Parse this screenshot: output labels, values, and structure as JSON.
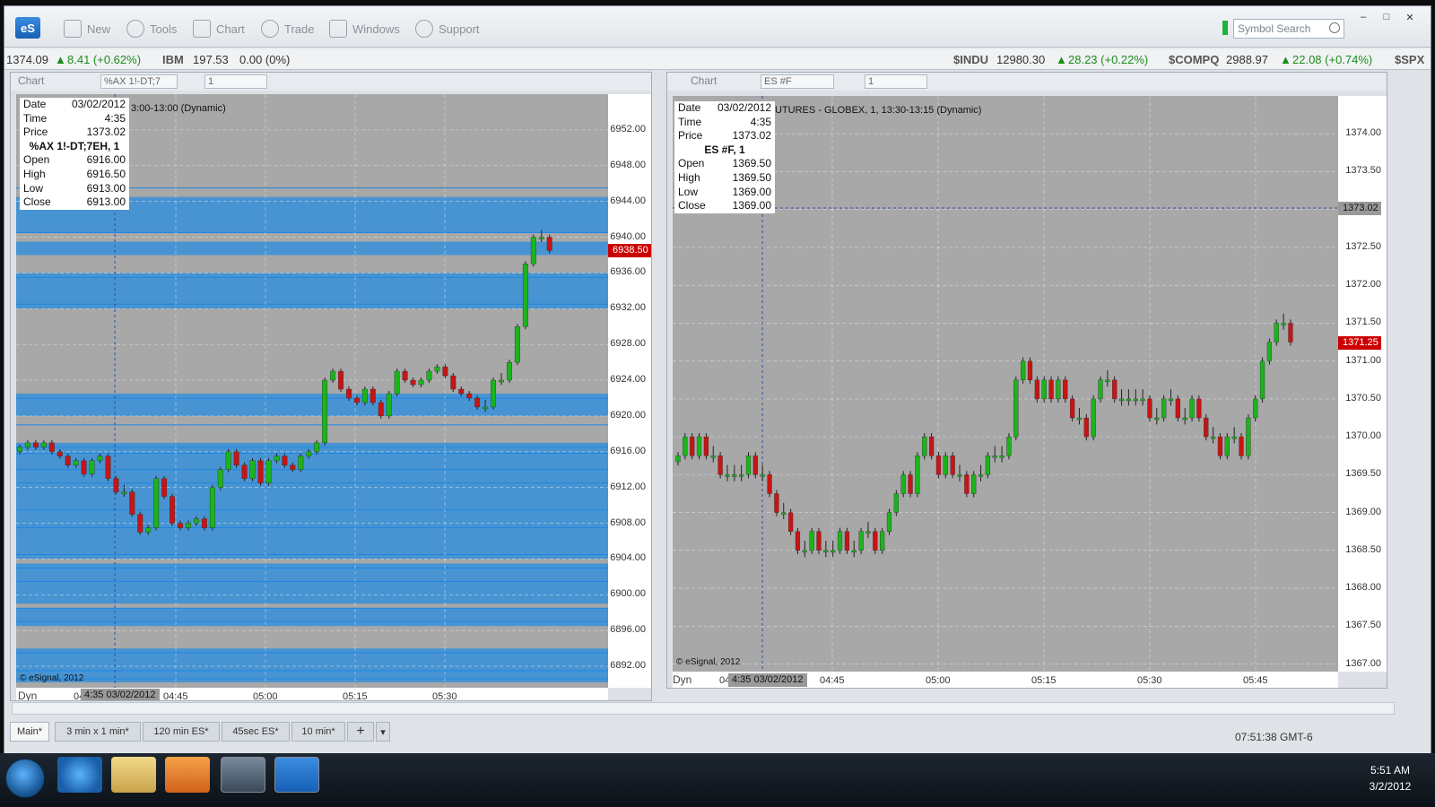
{
  "app": {
    "logo": "eS",
    "menu": [
      "New",
      "Tools",
      "Chart",
      "Trade",
      "Windows",
      "Support"
    ],
    "symbol_search_placeholder": "Symbol Search"
  },
  "ticker": {
    "item1_price": "1374.09",
    "item1_change": "8.41 (+0.62%)",
    "ibm_sym": "IBM",
    "ibm_price": "197.53",
    "ibm_change": "0.00 (0%)",
    "indu_sym": "$INDU",
    "indu_price": "12980.30",
    "indu_change": "28.23 (+0.22%)",
    "compq_sym": "$COMPQ",
    "compq_price": "2988.97",
    "compq_change": "22.08 (+0.74%)",
    "spx_sym": "$SPX"
  },
  "colors": {
    "plot_bg": "#a8a8a8",
    "band": "#208ce6",
    "up": "#19b51b",
    "down": "#c81414",
    "last_tag": "#cc0000"
  },
  "chart_data": [
    {
      "type": "candlestick",
      "window_label": "Chart",
      "symbol_field": "%AX 1!-DT;7",
      "interval_field": "1",
      "title": "3:00-13:00 (Dynamic)",
      "ylim": [
        6889.6,
        6956.0
      ],
      "yticks": [
        6952,
        6948,
        6944,
        6940,
        6936,
        6932,
        6928,
        6924,
        6920,
        6916,
        6912,
        6908,
        6904,
        6900,
        6896,
        6892
      ],
      "ytick_labels": [
        "6952.00",
        "6948.00",
        "6944.00",
        "6940.00",
        "6936.00",
        "6932.00",
        "6928.00",
        "6924.00",
        "6920.00",
        "6916.00",
        "6912.00",
        "6908.00",
        "6904.00",
        "6900.00",
        "6896.00",
        "6892.00"
      ],
      "xticks": [
        "04:45",
        "05:00",
        "05:15",
        "05:30"
      ],
      "last_price": "6938.50",
      "cursor_time": "4:35 03/02/2012",
      "cursor_time_prefix": "04",
      "data_window": {
        "date_label": "Date",
        "date": "03/02/2012",
        "time_label": "Time",
        "time": "4:35",
        "price_label": "Price",
        "price": "1373.02",
        "symbol": "%AX 1!-DT;7EH, 1",
        "open_label": "Open",
        "open": "6916.00",
        "high_label": "High",
        "high": "6916.50",
        "low_label": "Low",
        "low": "6913.00",
        "close_label": "Close",
        "close": "6913.00"
      },
      "copyright": "© eSignal, 2012",
      "dyn_label": "Dyn",
      "closes": [
        6916.5,
        6917,
        6916.5,
        6917,
        6916,
        6915.5,
        6914.5,
        6915,
        6913.5,
        6915,
        6915.5,
        6913,
        6911.5,
        6911.5,
        6909,
        6907,
        6907.5,
        6913,
        6911,
        6908,
        6907.5,
        6908,
        6908.5,
        6907.5,
        6912,
        6914,
        6916,
        6914.5,
        6913,
        6915,
        6912.5,
        6915,
        6915.5,
        6914.5,
        6914,
        6915.5,
        6916,
        6917,
        6924,
        6925,
        6923,
        6922,
        6921.5,
        6923,
        6921.5,
        6920,
        6922.5,
        6925,
        6924,
        6923.5,
        6924,
        6925,
        6925.5,
        6924.5,
        6923,
        6922.5,
        6922,
        6921,
        6921,
        6924,
        6924,
        6926,
        6930,
        6937,
        6940,
        6940,
        6938.5
      ],
      "horizontal_bands": [
        [
          6944.5,
          6940.5
        ],
        [
          6939.5,
          6938
        ],
        [
          6936,
          6932
        ],
        [
          6922.5,
          6920
        ],
        [
          6917,
          6904
        ],
        [
          6903.5,
          6899
        ],
        [
          6898.5,
          6896.5
        ],
        [
          6894,
          6890.2
        ]
      ],
      "horizontal_lines": [
        6945.5,
        6940.5,
        6935.5,
        6932.5,
        6922,
        6919,
        6916.5,
        6915.8,
        6914,
        6912.5,
        6909.5,
        6907.5,
        6904.5,
        6903,
        6901.5,
        6898.5,
        6897,
        6893.5,
        6891.5,
        6890.6
      ]
    },
    {
      "type": "candlestick",
      "window_label": "Chart",
      "symbol_field": "ES #F",
      "interval_field": "1",
      "title": "UTURES - GLOBEX, 1, 13:30-13:15 (Dynamic)",
      "ylim": [
        1366.9,
        1374.5
      ],
      "yticks": [
        1374.0,
        1373.5,
        1373.0,
        1372.5,
        1372.0,
        1371.5,
        1371.0,
        1370.5,
        1370.0,
        1369.5,
        1369.0,
        1368.5,
        1368.0,
        1367.5,
        1367.0
      ],
      "ytick_labels": [
        "1374.00",
        "1373.50",
        "1373.02",
        "1372.50",
        "1372.00",
        "1371.50",
        "1371.00",
        "1370.50",
        "1370.00",
        "1369.50",
        "1369.00",
        "1368.50",
        "1368.00",
        "1367.50",
        "1367.00"
      ],
      "xticks": [
        "04:45",
        "05:00",
        "05:15",
        "05:30",
        "05:45"
      ],
      "last_price": "1371.25",
      "crosshair_price": "1373.02",
      "cursor_time": "4:35 03/02/2012",
      "cursor_time_prefix": "04",
      "data_window": {
        "date_label": "Date",
        "date": "03/02/2012",
        "time_label": "Time",
        "time": "4:35",
        "price_label": "Price",
        "price": "1373.02",
        "symbol": "ES #F, 1",
        "open_label": "Open",
        "open": "1369.50",
        "high_label": "High",
        "high": "1369.50",
        "low_label": "Low",
        "low": "1369.00",
        "close_label": "Close",
        "close": "1369.00"
      },
      "copyright": "© eSignal, 2012",
      "dyn_label": "Dyn",
      "closes": [
        1369.75,
        1370,
        1369.75,
        1370,
        1369.75,
        1369.75,
        1369.5,
        1369.5,
        1369.5,
        1369.5,
        1369.75,
        1369.5,
        1369.5,
        1369.25,
        1369,
        1369,
        1368.75,
        1368.5,
        1368.5,
        1368.75,
        1368.5,
        1368.5,
        1368.5,
        1368.75,
        1368.5,
        1368.5,
        1368.75,
        1368.75,
        1368.5,
        1368.75,
        1369,
        1369.25,
        1369.5,
        1369.25,
        1369.75,
        1370,
        1369.75,
        1369.5,
        1369.75,
        1369.5,
        1369.5,
        1369.25,
        1369.5,
        1369.5,
        1369.75,
        1369.75,
        1369.75,
        1370,
        1370.75,
        1371,
        1370.75,
        1370.5,
        1370.75,
        1370.5,
        1370.75,
        1370.5,
        1370.25,
        1370.25,
        1370,
        1370.5,
        1370.75,
        1370.75,
        1370.5,
        1370.5,
        1370.5,
        1370.5,
        1370.5,
        1370.25,
        1370.25,
        1370.5,
        1370.5,
        1370.25,
        1370.25,
        1370.5,
        1370.25,
        1370,
        1370,
        1369.75,
        1370,
        1370,
        1369.75,
        1370.25,
        1370.5,
        1371,
        1371.25,
        1371.5,
        1371.5,
        1371.25
      ]
    }
  ],
  "tabs": [
    "Main*",
    "3 min x 1 min*",
    "120 min ES*",
    "45sec ES*",
    "10 min*"
  ],
  "status": {
    "clock": "07:51:38 GMT-6"
  },
  "taskbar": {
    "time": "5:51 AM",
    "date": "3/2/2012"
  }
}
